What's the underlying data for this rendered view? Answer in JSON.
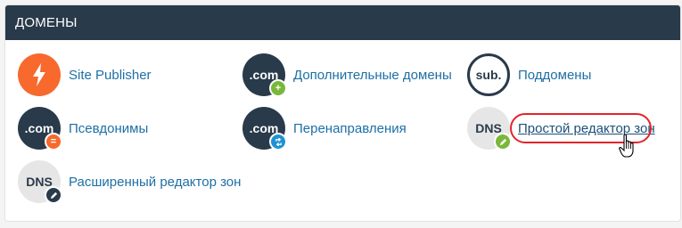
{
  "panel": {
    "title": "ДОМЕНЫ"
  },
  "items": [
    {
      "label": "Site Publisher",
      "icon": "lightning-bolt-icon"
    },
    {
      "label": "Дополнительные домены",
      "icon_text": ".com",
      "icon": "add-domain-icon"
    },
    {
      "label": "Поддомены",
      "icon_text": "sub.",
      "icon": "subdomain-icon"
    },
    {
      "label": "Псевдонимы",
      "icon_text": ".com",
      "icon": "alias-icon"
    },
    {
      "label": "Перенаправления",
      "icon_text": ".com",
      "icon": "redirect-icon"
    },
    {
      "label": "Простой редактор зон",
      "icon_text": "DNS",
      "icon": "dns-edit-icon"
    },
    {
      "label": "Расширенный редактор зон",
      "icon_text": "DNS",
      "icon": "dns-advanced-icon"
    }
  ],
  "colors": {
    "header_bg": "#293a4a",
    "link": "#1d6fa5",
    "accent_orange": "#f7692d",
    "highlight_red": "#e3242b"
  }
}
